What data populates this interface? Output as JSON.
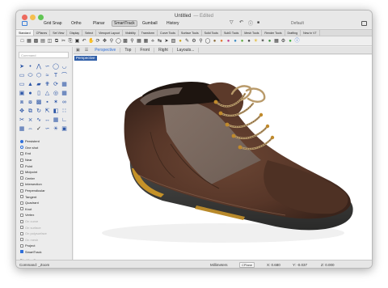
{
  "window": {
    "title": "Untitled",
    "edited": "— Edited"
  },
  "toolbar_top": {
    "grid_snap": "Grid Snap",
    "ortho": "Ortho",
    "planar": "Planar",
    "smarttrack": "SmartTrack",
    "gumball": "Gumball",
    "history": "History",
    "default": "Default"
  },
  "command_tabs": [
    "Standard",
    "CPlanes",
    "Set View",
    "Display",
    "Select",
    "Viewport Layout",
    "Visibility",
    "Transform",
    "Curve Tools",
    "Surface Tools",
    "Solid Tools",
    "SubD Tools",
    "Mesh Tools",
    "Render Tools",
    "Drafting",
    "New in V7"
  ],
  "command_input": {
    "placeholder": "Command"
  },
  "osnap": {
    "persistent": "Persistent",
    "one_shot": "One shot",
    "items": [
      {
        "label": "End",
        "checked": false,
        "enabled": true
      },
      {
        "label": "Near",
        "checked": false,
        "enabled": true
      },
      {
        "label": "Point",
        "checked": false,
        "enabled": true
      },
      {
        "label": "Midpoint",
        "checked": false,
        "enabled": true
      },
      {
        "label": "Center",
        "checked": false,
        "enabled": true
      },
      {
        "label": "Intersection",
        "checked": false,
        "enabled": true
      },
      {
        "label": "Perpendicular",
        "checked": false,
        "enabled": true
      },
      {
        "label": "Tangent",
        "checked": false,
        "enabled": true
      },
      {
        "label": "Quadrant",
        "checked": false,
        "enabled": true
      },
      {
        "label": "Knot",
        "checked": false,
        "enabled": true
      },
      {
        "label": "Vertex",
        "checked": false,
        "enabled": true
      },
      {
        "label": "On curve",
        "checked": false,
        "enabled": false
      },
      {
        "label": "On surface",
        "checked": false,
        "enabled": false
      },
      {
        "label": "On polysurface",
        "checked": false,
        "enabled": false
      },
      {
        "label": "On mesh",
        "checked": false,
        "enabled": false
      },
      {
        "label": "Project",
        "checked": false,
        "enabled": true
      },
      {
        "label": "SmartTrack",
        "checked": true,
        "enabled": true
      }
    ],
    "disable_all": "Disable all"
  },
  "viewport_tabs": [
    "Perspective",
    "Top",
    "Front",
    "Right",
    "Layouts..."
  ],
  "viewport": {
    "label": "Perspective"
  },
  "status": {
    "command": "Command: _Zoom",
    "units": "Millimeters",
    "cplane": "CPlane",
    "x": "X: 0.680",
    "y": "Y: -0.037",
    "z": "Z: 0.000"
  }
}
